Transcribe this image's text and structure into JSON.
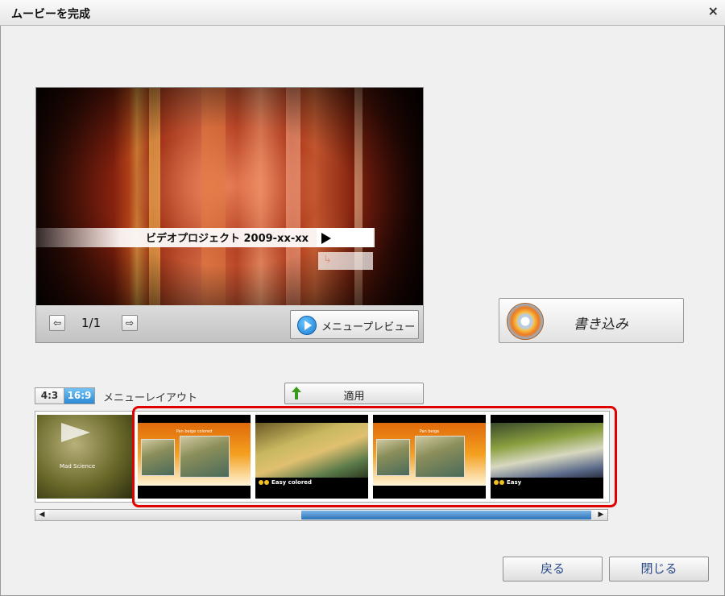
{
  "window": {
    "title": "ムービーを完成",
    "close_glyph": "×"
  },
  "preview": {
    "menu_title": "ビデオプロジェクト 2009-xx-xx",
    "return_glyph": "↳",
    "prev_glyph": "⇦",
    "next_glyph": "⇨",
    "page_indicator": "1/1",
    "menu_preview_label": "メニュープレビュー"
  },
  "burn_button": {
    "label": "書き込み",
    "icon": "disc-flame-icon"
  },
  "layout": {
    "ratio_43": "4:3",
    "ratio_169": "16:9",
    "selected_ratio": "16:9",
    "label": "メニューレイアウト",
    "apply_label": "適用"
  },
  "thumbnails": [
    {
      "caption": "Mad Science",
      "style": "science"
    },
    {
      "caption": "Pan beige colored",
      "style": "pan-beige"
    },
    {
      "caption": "Easy colored",
      "style": "easy"
    },
    {
      "caption": "Pan beige",
      "style": "pan-beige"
    },
    {
      "caption": "Easy",
      "style": "easy"
    }
  ],
  "highlight_color": "#e00000",
  "accent_color": "#2a8ad4",
  "scrollbar": {
    "left_glyph": "◀",
    "right_glyph": "▶"
  },
  "footer": {
    "back_label": "戻る",
    "close_label": "閉じる"
  }
}
